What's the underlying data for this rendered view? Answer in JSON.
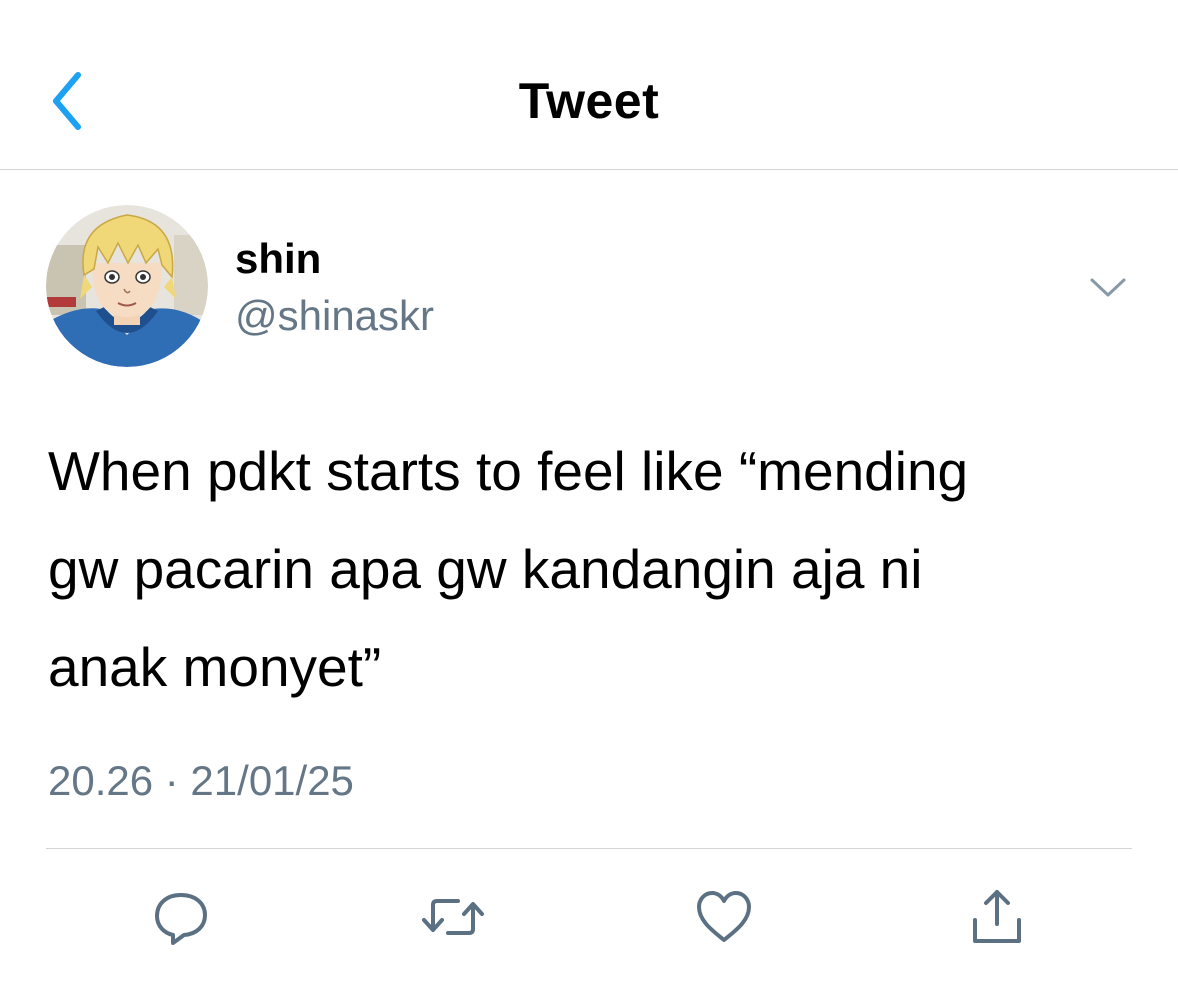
{
  "header": {
    "title": "Tweet",
    "back_icon": "chevron-left-icon",
    "accent_color": "#1da1f2"
  },
  "author": {
    "display_name": "shin",
    "handle": "@shinaskr",
    "avatar": "anime-avatar"
  },
  "tweet": {
    "text_lines": [
      "When pdkt starts to feel like “mending",
      "gw pacarin apa gw kandangin aja ni",
      "anak monyet”"
    ],
    "timestamp": "20.26 · 21/01/25"
  },
  "actions": [
    {
      "name": "reply",
      "icon": "reply-icon"
    },
    {
      "name": "retweet",
      "icon": "retweet-icon"
    },
    {
      "name": "like",
      "icon": "heart-icon"
    },
    {
      "name": "share",
      "icon": "share-icon"
    }
  ],
  "colors": {
    "text_primary": "#000000",
    "text_secondary": "#657786",
    "divider": "#d4d4d6",
    "icon_gray": "#5b7083"
  }
}
